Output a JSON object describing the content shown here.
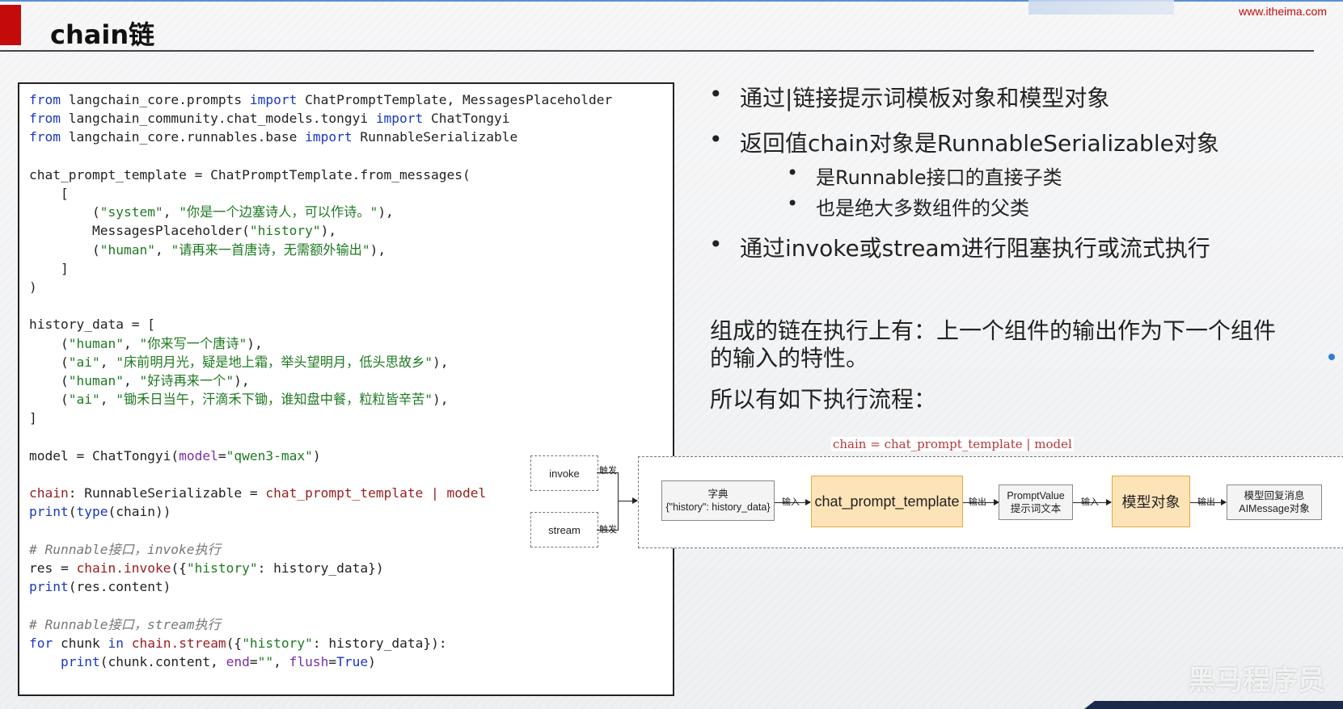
{
  "header": {
    "title": "chain链",
    "brand_url": "www.itheima.com",
    "accent_color": "#c40a0a"
  },
  "code_lines": [
    [
      {
        "t": "from",
        "c": "kw"
      },
      {
        "t": " langchain_core.prompts "
      },
      {
        "t": "import",
        "c": "kw"
      },
      {
        "t": " ChatPromptTemplate, MessagesPlaceholder"
      }
    ],
    [
      {
        "t": "from",
        "c": "kw"
      },
      {
        "t": " langchain_community.chat_models.tongyi "
      },
      {
        "t": "import",
        "c": "kw"
      },
      {
        "t": " ChatTongyi"
      }
    ],
    [
      {
        "t": "from",
        "c": "kw"
      },
      {
        "t": " langchain_core.runnables.base "
      },
      {
        "t": "import",
        "c": "kw"
      },
      {
        "t": " RunnableSerializable"
      }
    ],
    [],
    [
      {
        "t": "chat_prompt_template = ChatPromptTemplate.from_messages("
      }
    ],
    [
      {
        "t": "    ["
      }
    ],
    [
      {
        "t": "        ("
      },
      {
        "t": "\"system\"",
        "c": "str"
      },
      {
        "t": ", "
      },
      {
        "t": "\"你是一个边塞诗人，可以作诗。\"",
        "c": "str"
      },
      {
        "t": "),"
      }
    ],
    [
      {
        "t": "        MessagesPlaceholder("
      },
      {
        "t": "\"history\"",
        "c": "str"
      },
      {
        "t": "),"
      }
    ],
    [
      {
        "t": "        ("
      },
      {
        "t": "\"human\"",
        "c": "str"
      },
      {
        "t": ", "
      },
      {
        "t": "\"请再来一首唐诗，无需额外输出\"",
        "c": "str"
      },
      {
        "t": "),"
      }
    ],
    [
      {
        "t": "    ]"
      }
    ],
    [
      {
        "t": ")"
      }
    ],
    [],
    [
      {
        "t": "history_data = ["
      }
    ],
    [
      {
        "t": "    ("
      },
      {
        "t": "\"human\"",
        "c": "str"
      },
      {
        "t": ", "
      },
      {
        "t": "\"你来写一个唐诗\"",
        "c": "str"
      },
      {
        "t": "),"
      }
    ],
    [
      {
        "t": "    ("
      },
      {
        "t": "\"ai\"",
        "c": "str"
      },
      {
        "t": ", "
      },
      {
        "t": "\"床前明月光，疑是地上霜，举头望明月，低头思故乡\"",
        "c": "str"
      },
      {
        "t": "),"
      }
    ],
    [
      {
        "t": "    ("
      },
      {
        "t": "\"human\"",
        "c": "str"
      },
      {
        "t": ", "
      },
      {
        "t": "\"好诗再来一个\"",
        "c": "str"
      },
      {
        "t": "),"
      }
    ],
    [
      {
        "t": "    ("
      },
      {
        "t": "\"ai\"",
        "c": "str"
      },
      {
        "t": ", "
      },
      {
        "t": "\"锄禾日当午，汗滴禾下锄，谁知盘中餐，粒粒皆辛苦\"",
        "c": "str"
      },
      {
        "t": "),"
      }
    ],
    [
      {
        "t": "]"
      }
    ],
    [],
    [
      {
        "t": "model = ChatTongyi("
      },
      {
        "t": "model",
        "c": "kwarg"
      },
      {
        "t": "="
      },
      {
        "t": "\"qwen3-max\"",
        "c": "str"
      },
      {
        "t": ")"
      }
    ],
    [],
    [
      {
        "t": "chain",
        "c": "fn"
      },
      {
        "t": ": RunnableSerializable = "
      },
      {
        "t": "chat_prompt_template | model",
        "c": "fn"
      }
    ],
    [
      {
        "t": "print",
        "c": "kw"
      },
      {
        "t": "("
      },
      {
        "t": "type",
        "c": "kw"
      },
      {
        "t": "(chain))"
      }
    ],
    [],
    [
      {
        "t": "# Runnable接口，invoke执行",
        "c": "cm"
      }
    ],
    [
      {
        "t": "res = "
      },
      {
        "t": "chain.invoke",
        "c": "fn"
      },
      {
        "t": "({"
      },
      {
        "t": "\"history\"",
        "c": "str"
      },
      {
        "t": ": history_data})"
      }
    ],
    [
      {
        "t": "print",
        "c": "kw"
      },
      {
        "t": "(res.content)"
      }
    ],
    [],
    [
      {
        "t": "# Runnable接口，stream执行",
        "c": "cm"
      }
    ],
    [
      {
        "t": "for",
        "c": "kw"
      },
      {
        "t": " chunk "
      },
      {
        "t": "in",
        "c": "kw"
      },
      {
        "t": " "
      },
      {
        "t": "chain.stream",
        "c": "fn"
      },
      {
        "t": "({"
      },
      {
        "t": "\"history\"",
        "c": "str"
      },
      {
        "t": ": history_data}):"
      }
    ],
    [
      {
        "t": "    "
      },
      {
        "t": "print",
        "c": "kw"
      },
      {
        "t": "(chunk.content, "
      },
      {
        "t": "end",
        "c": "kwarg"
      },
      {
        "t": "="
      },
      {
        "t": "\"\"",
        "c": "str"
      },
      {
        "t": ", "
      },
      {
        "t": "flush",
        "c": "kwarg"
      },
      {
        "t": "="
      },
      {
        "t": "True",
        "c": "kw"
      },
      {
        "t": ")"
      }
    ]
  ],
  "bullets": {
    "b1": "通过|链接提示词模板对象和模型对象",
    "b2": "返回值chain对象是RunnableSerializable对象",
    "b2a": "是Runnable接口的直接子类",
    "b2b": "也是绝大多数组件的父类",
    "b3": "通过invoke或stream进行阻塞执行或流式执行",
    "dot": "•"
  },
  "paragraph": {
    "line1": "组成的链在执行上有：上一个组件的输出作为下一个组件",
    "line2": "的输入的特性。",
    "line3": "所以有如下执行流程："
  },
  "flow": {
    "code_label": "chain = chat_prompt_template | model",
    "invoke": "invoke",
    "stream": "stream",
    "trigger": "触发",
    "dict_title": "字典",
    "dict_value": "{\"history\": history_data}",
    "input": "输入",
    "output": "输出",
    "template": "chat_prompt_template",
    "prompt_value_1": "PromptValue",
    "prompt_value_2": "提示词文本",
    "model": "模型对象",
    "reply_1": "模型回复消息",
    "reply_2": "AIMessage对象"
  },
  "watermark": "黑马程序员"
}
